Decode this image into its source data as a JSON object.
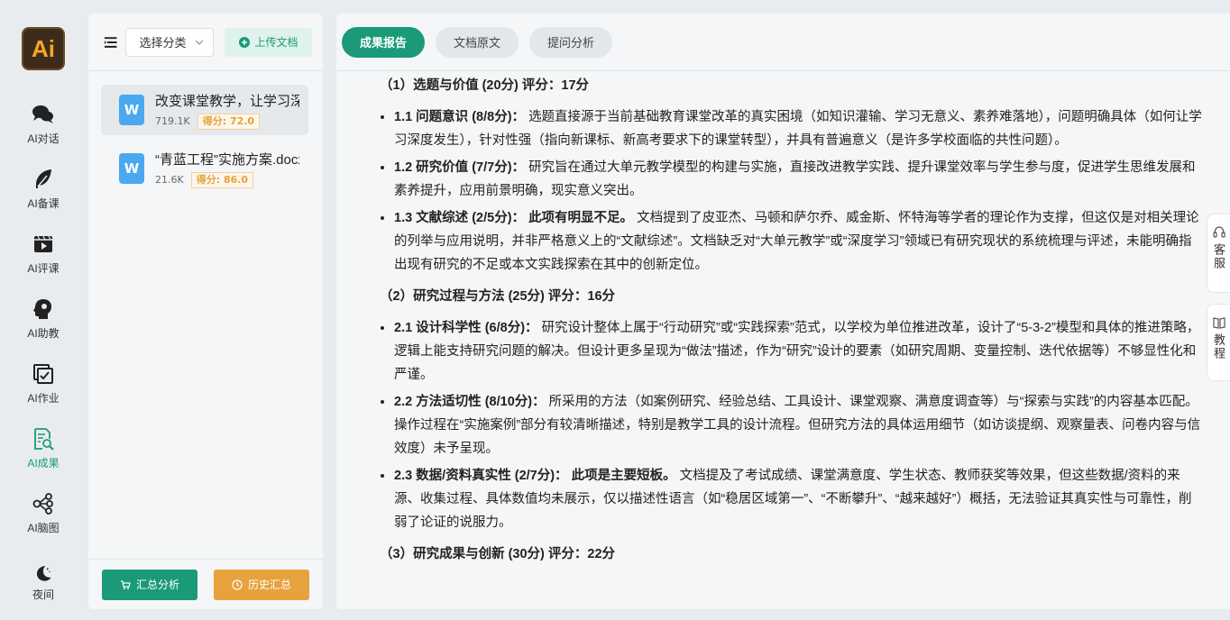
{
  "rail": {
    "logo": "Ai",
    "items": [
      {
        "label": "AI对话",
        "icon": "chat-icon"
      },
      {
        "label": "AI备课",
        "icon": "feather-icon"
      },
      {
        "label": "AI评课",
        "icon": "video-icon"
      },
      {
        "label": "AI助教",
        "icon": "head-icon"
      },
      {
        "label": "AI作业",
        "icon": "homework-icon"
      },
      {
        "label": "AI成果",
        "icon": "report-search-icon"
      },
      {
        "label": "AI脑图",
        "icon": "mindmap-icon"
      },
      {
        "label": "夜间",
        "icon": "moon-icon"
      }
    ],
    "active_index": 5
  },
  "files": {
    "category_placeholder": "选择分类",
    "upload_label": "上传文档",
    "items": [
      {
        "name": "改变课堂教学，让学习深度发生",
        "size": "719.1K",
        "score": "得分: 72.0"
      },
      {
        "name": "“青蓝工程”实施方案.docx",
        "size": "21.6K",
        "score": "得分: 86.0"
      }
    ],
    "summary_label": "汇总分析",
    "history_label": "历史汇总"
  },
  "tabs": [
    "成果报告",
    "文档原文",
    "提问分析"
  ],
  "report": {
    "s1": {
      "title": "（1）选题与价值 (20分) 评分：17分",
      "items": [
        {
          "head": "1.1 问题意识 (8/8分)：",
          "strong": "",
          "text": "选题直接源于当前基础教育课堂改革的真实困境（如知识灌输、学习无意义、素养难落地），问题明确具体（如何让学习深度发生），针对性强（指向新课标、新高考要求下的课堂转型），并具有普遍意义（是许多学校面临的共性问题）。"
        },
        {
          "head": "1.2 研究价值 (7/7分)：",
          "strong": "",
          "text": "研究旨在通过大单元教学模型的构建与实施，直接改进教学实践、提升课堂效率与学生参与度，促进学生思维发展和素养提升，应用前景明确，现实意义突出。"
        },
        {
          "head": "1.3 文献综述 (2/5分)：",
          "strong": "此项有明显不足。",
          "text": "文档提到了皮亚杰、马顿和萨尔乔、威金斯、怀特海等学者的理论作为支撑，但这仅是对相关理论的列举与应用说明，并非严格意义上的“文献综述”。文档缺乏对“大单元教学”或“深度学习”领域已有研究现状的系统梳理与评述，未能明确指出现有研究的不足或本文实践探索在其中的创新定位。"
        }
      ]
    },
    "s2": {
      "title": "（2）研究过程与方法 (25分) 评分：16分",
      "items": [
        {
          "head": "2.1 设计科学性 (6/8分)：",
          "strong": "",
          "text": "研究设计整体上属于“行动研究”或“实践探索”范式，以学校为单位推进改革，设计了“5-3-2”模型和具体的推进策略，逻辑上能支持研究问题的解决。但设计更多呈现为“做法”描述，作为“研究”设计的要素（如研究周期、变量控制、迭代依据等）不够显性化和严谨。"
        },
        {
          "head": "2.2 方法适切性 (8/10分)：",
          "strong": "",
          "text": "所采用的方法（如案例研究、经验总结、工具设计、课堂观察、满意度调查等）与“探索与实践”的内容基本匹配。操作过程在“实施案例”部分有较清晰描述，特别是教学工具的设计流程。但研究方法的具体运用细节（如访谈提纲、观察量表、问卷内容与信效度）未予呈现。"
        },
        {
          "head": "2.3 数据/资料真实性 (2/7分)：",
          "strong": "此项是主要短板。",
          "text": "文档提及了考试成绩、课堂满意度、学生状态、教师获奖等效果，但这些数据/资料的来源、收集过程、具体数值均未展示，仅以描述性语言（如“稳居区域第一”、“不断攀升”、“越来越好”）概括，无法验证其真实性与可靠性，削弱了论证的说服力。"
        }
      ]
    },
    "s3": {
      "title": "（3）研究成果与创新 (30分) 评分：22分"
    }
  },
  "float": {
    "service": "客服",
    "tutorial": "教程"
  },
  "colors": {
    "accent": "#1a9a78",
    "warning": "#e6a23c",
    "doc_blue": "#4aa8f0"
  }
}
